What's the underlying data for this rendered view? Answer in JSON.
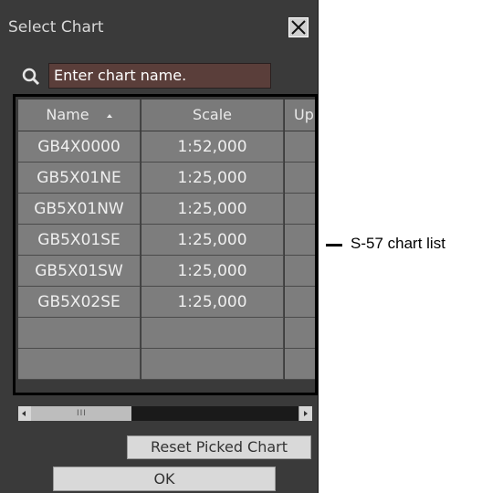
{
  "dialog": {
    "title": "Select Chart",
    "close_icon": "close-icon"
  },
  "search": {
    "icon": "search-icon",
    "placeholder": "Enter chart name."
  },
  "table": {
    "columns": [
      {
        "label": "Name",
        "sort": "ascending"
      },
      {
        "label": "Scale"
      },
      {
        "label": "Up"
      }
    ],
    "rows": [
      {
        "name": "GB4X0000",
        "scale": "1:52,000",
        "up": ""
      },
      {
        "name": "GB5X01NE",
        "scale": "1:25,000",
        "up": ""
      },
      {
        "name": "GB5X01NW",
        "scale": "1:25,000",
        "up": ""
      },
      {
        "name": "GB5X01SE",
        "scale": "1:25,000",
        "up": ""
      },
      {
        "name": "GB5X01SW",
        "scale": "1:25,000",
        "up": ""
      },
      {
        "name": "GB5X02SE",
        "scale": "1:25,000",
        "up": ""
      }
    ]
  },
  "scrollbar": {
    "grip": "III"
  },
  "buttons": {
    "reset_label": "Reset Picked Chart",
    "ok_label": "OK"
  },
  "annotation": {
    "callout": "S-57 chart list"
  },
  "colors": {
    "dialog_bg": "#3a3a3a",
    "cell_bg": "#7d7d7d",
    "search_bg": "#5a3e3a",
    "highlight_border": "#000000"
  }
}
